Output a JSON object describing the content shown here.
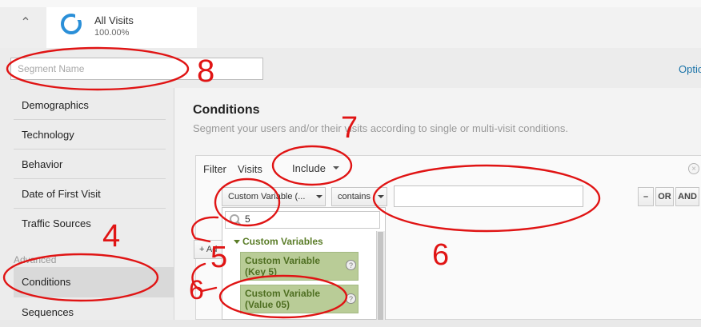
{
  "header": {
    "segment": {
      "title": "All Visits",
      "percent": "100.00%"
    }
  },
  "segment_name": {
    "placeholder": "Segment Name"
  },
  "options_link": "Optio",
  "nav": {
    "items": [
      "Demographics",
      "Technology",
      "Behavior",
      "Date of First Visit",
      "Traffic Sources"
    ],
    "advanced_label": "Advanced",
    "active": "Conditions",
    "below": "Sequences"
  },
  "main": {
    "title": "Conditions",
    "subtitle": "Segment your users and/or their visits according to single or multi-visit conditions.",
    "filter": {
      "label": "Filter",
      "scope": "Visits",
      "mode": "Include",
      "dimension_dropdown": "Custom Variable (...",
      "operator_dropdown": "contains",
      "value": "",
      "buttons": {
        "remove": "–",
        "or": "OR",
        "and": "AND"
      },
      "add_label": "+ Ad"
    },
    "dropdown": {
      "search_value": "5",
      "category": "Custom Variables",
      "options": [
        {
          "line1": "Custom Variable",
          "line2": "(Key 5)"
        },
        {
          "line1": "Custom Variable",
          "line2": "(Value 05)"
        }
      ],
      "help_glyph": "?"
    }
  },
  "annotations": {
    "labels": [
      "8",
      "7",
      "6",
      "4",
      "5",
      "6"
    ],
    "color": "#e01414"
  },
  "colors": {
    "accent": "#2a8fd8",
    "option_bg": "#b9cc97",
    "option_text": "#4f6f22",
    "link": "#1a73a8"
  }
}
